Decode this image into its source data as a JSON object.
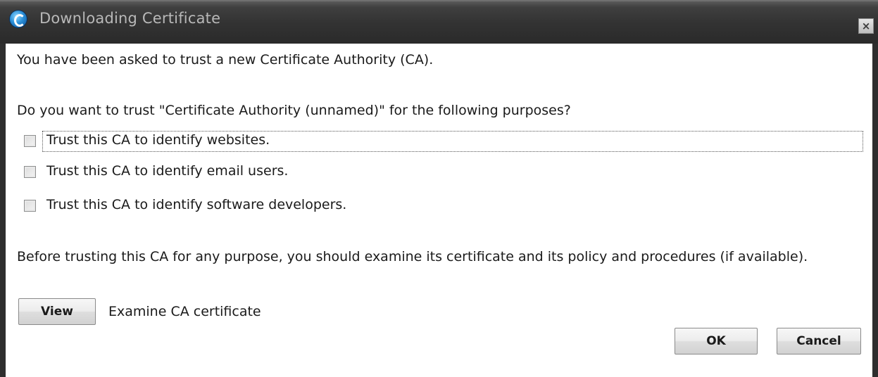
{
  "window": {
    "title": "Downloading Certificate",
    "app_icon": "browser-icon",
    "close_icon": "close-icon",
    "close_glyph": "×"
  },
  "dialog": {
    "intro": "You have been asked to trust a new Certificate Authority (CA).",
    "question": "Do you want to trust \"Certificate Authority (unnamed)\" for the following purposes?",
    "options": [
      {
        "label": "Trust this CA to identify websites.",
        "checked": false
      },
      {
        "label": "Trust this CA to identify email users.",
        "checked": false
      },
      {
        "label": "Trust this CA to identify software developers.",
        "checked": false
      }
    ],
    "advice": "Before trusting this CA for any purpose, you should examine its certificate and its policy and procedures (if available).",
    "view_button": "View",
    "view_description": "Examine CA certificate",
    "ok_button": "OK",
    "cancel_button": "Cancel"
  }
}
